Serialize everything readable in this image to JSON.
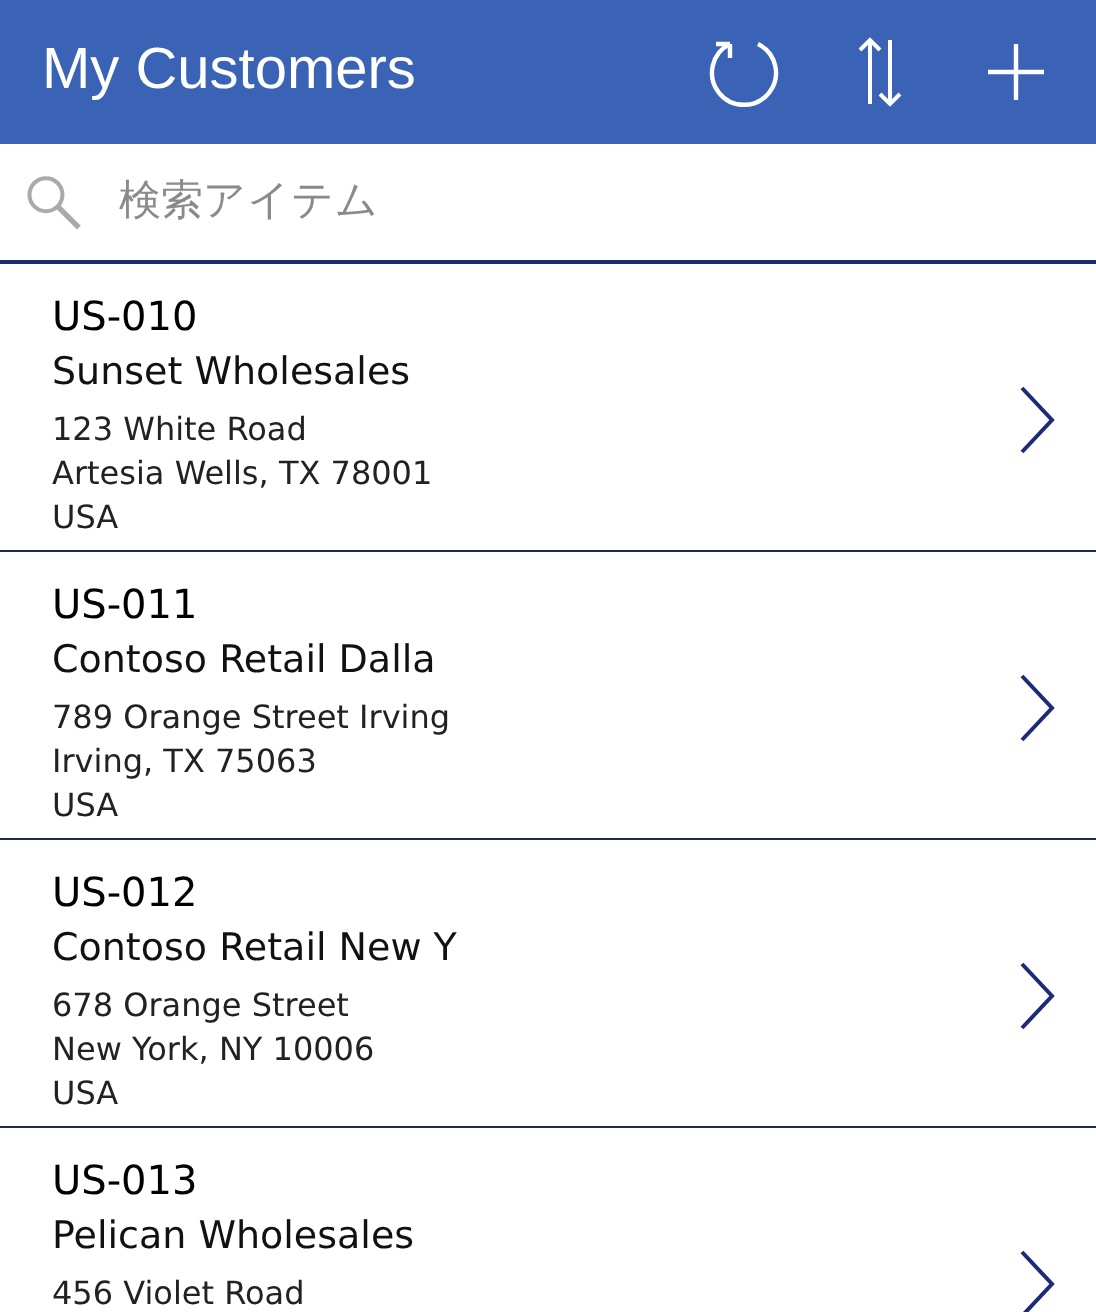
{
  "header": {
    "title": "My Customers"
  },
  "search": {
    "placeholder": "検索アイテム"
  },
  "customers": [
    {
      "id": "US-010",
      "name": "Sunset Wholesales",
      "address": [
        "123 White Road",
        "Artesia Wells, TX 78001",
        "USA"
      ]
    },
    {
      "id": "US-011",
      "name": "Contoso Retail Dalla",
      "address": [
        "789 Orange Street Irving",
        "Irving, TX 75063",
        "USA"
      ]
    },
    {
      "id": "US-012",
      "name": "Contoso Retail New Y",
      "address": [
        "678 Orange Street",
        "New York, NY 10006",
        "USA"
      ]
    },
    {
      "id": "US-013",
      "name": "Pelican Wholesales",
      "address": [
        "456 Violet Road"
      ]
    }
  ]
}
